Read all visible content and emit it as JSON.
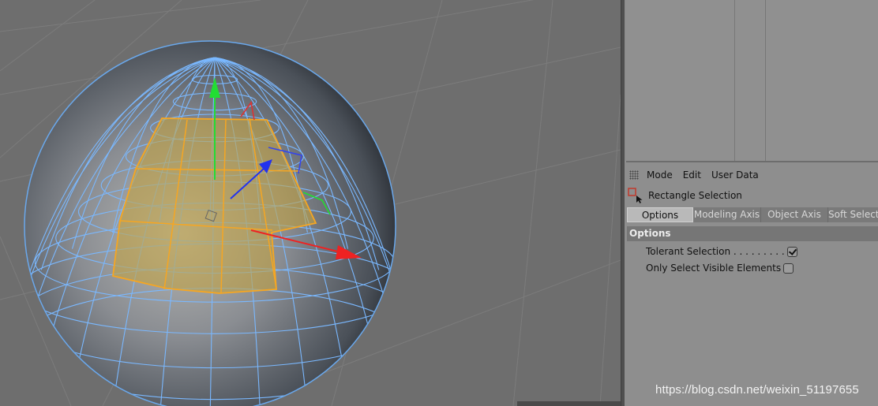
{
  "attributes_menu": {
    "mode": "Mode",
    "edit": "Edit",
    "user_data": "User Data"
  },
  "tool": {
    "name": "Rectangle Selection",
    "icon": "rectangle-selection-icon"
  },
  "tabs": [
    {
      "label": "Options",
      "active": true
    },
    {
      "label": "Modeling Axis",
      "active": false
    },
    {
      "label": "Object Axis",
      "active": false
    },
    {
      "label": "Soft Selection",
      "active": false
    }
  ],
  "section": {
    "title": "Options"
  },
  "options": [
    {
      "label": "Tolerant Selection . . . . . . . . .",
      "checked": true
    },
    {
      "label": "Only Select Visible Elements",
      "checked": false
    }
  ],
  "watermark": "https://blog.csdn.net/weixin_51197655",
  "colors": {
    "viewport_bg": "#6e6e6e",
    "wireframe": "#7ab8ff",
    "selection": "#f5a623",
    "axis_y": "#22dd33",
    "axis_x": "#ee2222",
    "axis_z": "#2233ee"
  }
}
